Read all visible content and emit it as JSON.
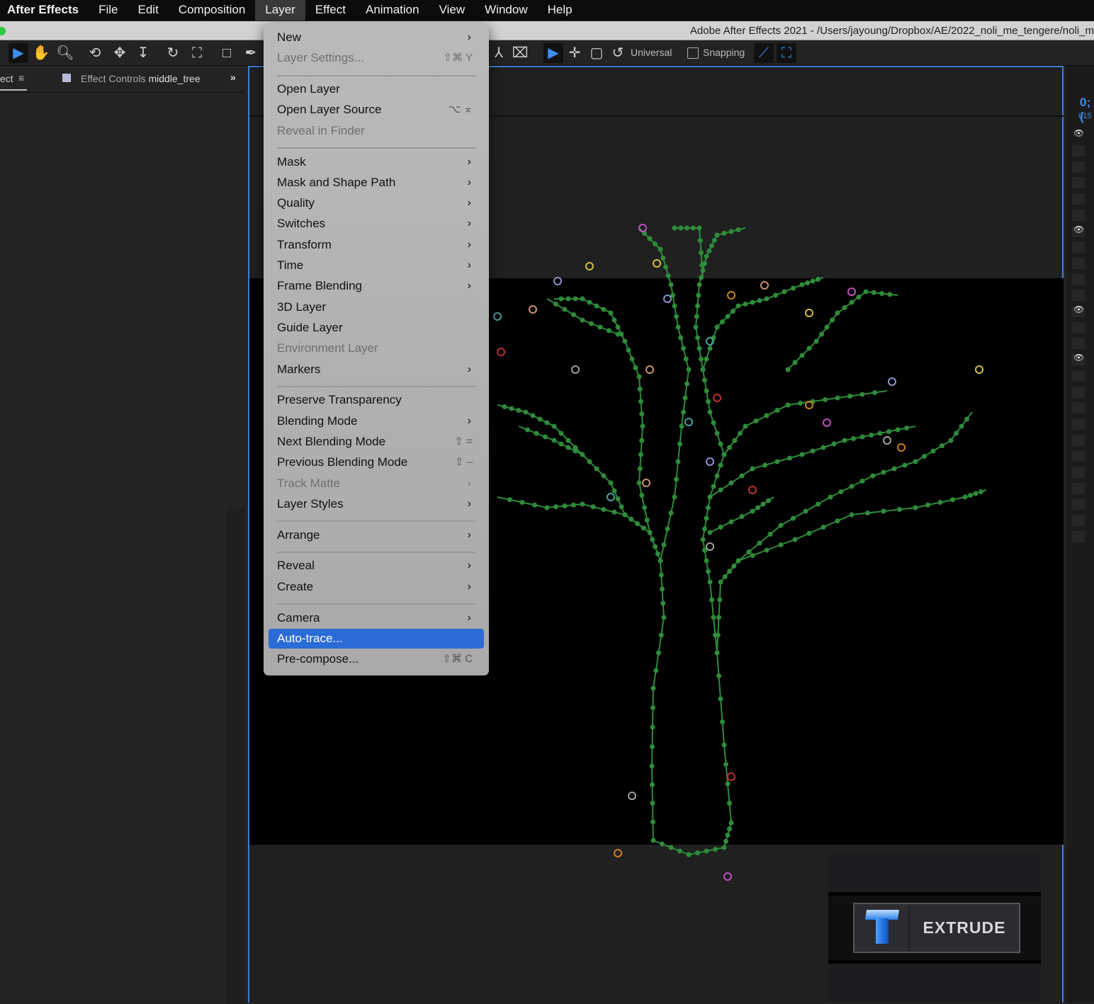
{
  "menubar": {
    "app": "After Effects",
    "items": [
      "File",
      "Edit",
      "Composition",
      "Layer",
      "Effect",
      "Animation",
      "View",
      "Window",
      "Help"
    ],
    "active": "Layer"
  },
  "window": {
    "title": "Adobe After Effects 2021 - /Users/jayoung/Dropbox/AE/2022_noli_me_tengere/noli_m"
  },
  "toolbar": {
    "axis_mode": "Universal",
    "snapping_label": "Snapping",
    "snapping_checked": false
  },
  "left_panel": {
    "tab_partial": "ect",
    "tab_effect_controls_prefix": "Effect Controls",
    "tab_effect_controls_layer": "middle_tree"
  },
  "right_panel": {
    "timecode": "0;(",
    "frame": "015"
  },
  "layer_menu": [
    {
      "label": "New",
      "submenu": true
    },
    {
      "label": "Layer Settings...",
      "shortcut": "⇧⌘ Y",
      "disabled": true
    },
    {
      "sep": true
    },
    {
      "label": "Open Layer"
    },
    {
      "label": "Open Layer Source",
      "shortcut": "⌥ ⌅"
    },
    {
      "label": "Reveal in Finder",
      "disabled": true
    },
    {
      "sep": true
    },
    {
      "label": "Mask",
      "submenu": true
    },
    {
      "label": "Mask and Shape Path",
      "submenu": true
    },
    {
      "label": "Quality",
      "submenu": true
    },
    {
      "label": "Switches",
      "submenu": true
    },
    {
      "label": "Transform",
      "submenu": true
    },
    {
      "label": "Time",
      "submenu": true
    },
    {
      "label": "Frame Blending",
      "submenu": true
    },
    {
      "label": "3D Layer"
    },
    {
      "label": "Guide Layer"
    },
    {
      "label": "Environment Layer",
      "disabled": true
    },
    {
      "label": "Markers",
      "submenu": true
    },
    {
      "sep": true
    },
    {
      "label": "Preserve Transparency"
    },
    {
      "label": "Blending Mode",
      "submenu": true
    },
    {
      "label": "Next Blending Mode",
      "shortcut": "⇧ ="
    },
    {
      "label": "Previous Blending Mode",
      "shortcut": "⇧ –"
    },
    {
      "label": "Track Matte",
      "submenu": true,
      "disabled": true
    },
    {
      "label": "Layer Styles",
      "submenu": true
    },
    {
      "sep": true
    },
    {
      "label": "Arrange",
      "submenu": true
    },
    {
      "sep": true
    },
    {
      "label": "Reveal",
      "submenu": true
    },
    {
      "label": "Create",
      "submenu": true
    },
    {
      "sep": true
    },
    {
      "label": "Camera",
      "submenu": true
    },
    {
      "label": "Auto-trace...",
      "highlighted": true
    },
    {
      "label": "Pre-compose...",
      "shortcut": "⇧⌘ C"
    }
  ],
  "extrude": {
    "label": "EXTRUDE"
  },
  "colors": {
    "accent": "#2b6bd6",
    "panel_border": "#3b7fd6",
    "tree_green": "#2e8b3a"
  }
}
